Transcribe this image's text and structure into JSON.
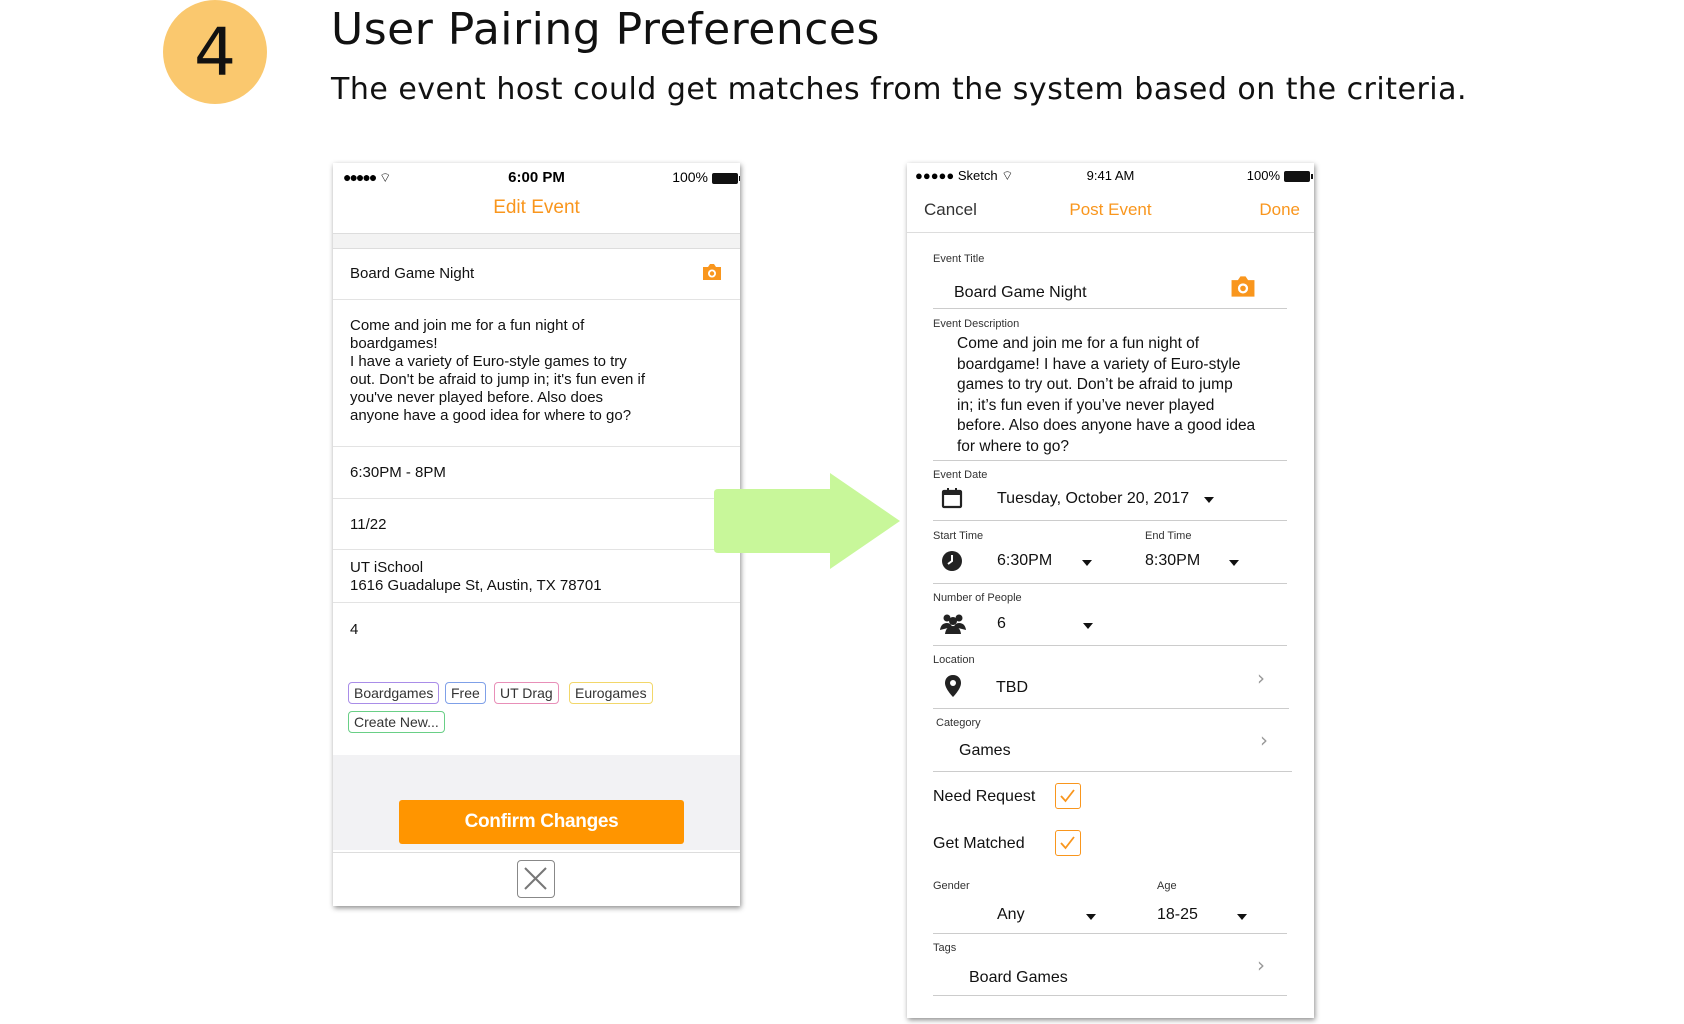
{
  "step": {
    "number": "4",
    "title": "User Pairing Preferences",
    "subtitle": "The event host could get matches from the system based on the criteria."
  },
  "old_screen": {
    "status": {
      "signal": "●●●●●",
      "time": "6:00 PM",
      "battery": "100%"
    },
    "nav_title": "Edit Event",
    "title": "Board Game Night",
    "description": [
      "Come and join me for a fun night of",
      "boardgames!",
      "I have a variety of Euro-style games to try",
      "out. Don't be afraid to jump in; it's fun even if",
      "you've never played before. Also does",
      "anyone have a good idea for where to go?"
    ],
    "time": "6:30PM - 8PM",
    "date": "11/22",
    "location_line1": "UT iSchool",
    "location_line2": "1616 Guadalupe St, Austin, TX 78701",
    "people": "4",
    "tags": [
      {
        "label": "Boardgames",
        "color": "#a98de8"
      },
      {
        "label": "Free",
        "color": "#7fa0e8"
      },
      {
        "label": "UT Drag",
        "color": "#e88fb8"
      },
      {
        "label": "Eurogames",
        "color": "#f2d76a"
      },
      {
        "label": "Create New...",
        "color": "#69cf86"
      }
    ],
    "confirm_label": "Confirm Changes",
    "accent": "#ff9500"
  },
  "new_screen": {
    "status": {
      "carrier": "●●●●● Sketch",
      "time": "9:41 AM",
      "battery": "100%"
    },
    "cancel_label": "Cancel",
    "nav_title": "Post Event",
    "done_label": "Done",
    "event_title_label": "Event Title",
    "event_title": "Board Game Night",
    "event_description_label": "Event Description",
    "event_description": [
      "Come and join me for a fun night of",
      "boardgame! I have a variety of Euro-style",
      "games to try out. Don’t be afraid to jump",
      "in; it’s fun even if you’ve never played",
      "before. Also does anyone have a good idea",
      "for where to go?"
    ],
    "event_date_label": "Event Date",
    "event_date": "Tuesday, October 20, 2017",
    "start_time_label": "Start Time",
    "start_time": "6:30PM",
    "end_time_label": "End Time",
    "end_time": "8:30PM",
    "people_label": "Number of People",
    "people": "6",
    "location_label": "Location",
    "location": "TBD",
    "category_label": "Category",
    "category": "Games",
    "need_request_label": "Need Request",
    "need_request_checked": true,
    "get_matched_label": "Get Matched",
    "get_matched_checked": true,
    "gender_label": "Gender",
    "gender": "Any",
    "age_label": "Age",
    "age": "18-25",
    "tags_label": "Tags",
    "tags": "Board Games",
    "accent": "#f9961d"
  },
  "arrow_color": "#c8f79a"
}
